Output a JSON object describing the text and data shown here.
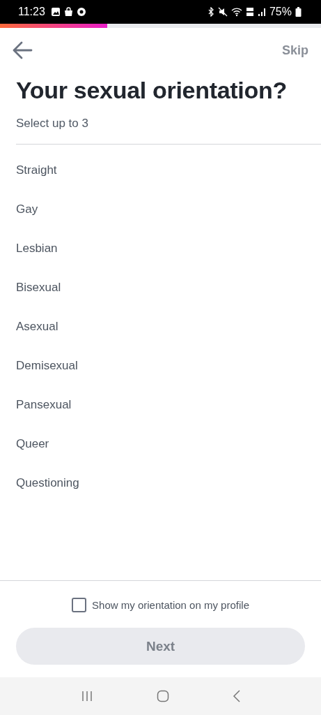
{
  "status_bar": {
    "time": "11:23",
    "battery": "75%"
  },
  "progress": {
    "level": 0.335
  },
  "header": {
    "skip": "Skip"
  },
  "title": "Your sexual orientation?",
  "subtitle": "Select up to 3",
  "options": [
    {
      "label": "Straight",
      "selected": false
    },
    {
      "label": "Gay",
      "selected": false
    },
    {
      "label": "Lesbian",
      "selected": false
    },
    {
      "label": "Bisexual",
      "selected": false
    },
    {
      "label": "Asexual",
      "selected": false
    },
    {
      "label": "Demisexual",
      "selected": false
    },
    {
      "label": "Pansexual",
      "selected": false
    },
    {
      "label": "Queer",
      "selected": false
    },
    {
      "label": "Questioning",
      "selected": false
    }
  ],
  "show_on_profile": {
    "label": "Show my orientation on my profile",
    "checked": false
  },
  "next_button": {
    "label": "Next",
    "disabled": true
  }
}
